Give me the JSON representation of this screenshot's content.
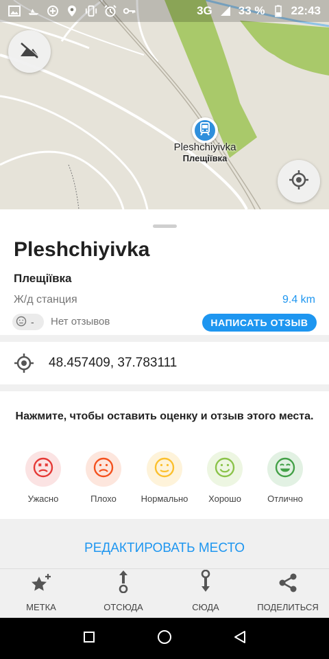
{
  "status_bar": {
    "network": "3G",
    "battery": "33 %",
    "time": "22:43",
    "icons": [
      "image-icon",
      "speedboat-icon",
      "data-saver-icon",
      "location-icon",
      "vibrate-icon",
      "alarm-icon",
      "key-icon",
      "signal-icon",
      "battery-icon"
    ]
  },
  "map": {
    "station_name": "Pleshchiyivka",
    "station_name_local": "Плещіївка",
    "icons": [
      "terrain-off-icon",
      "my-location-icon",
      "train-station-icon"
    ]
  },
  "place": {
    "title": "Pleshchiyivka",
    "subtitle": "Плещіївка",
    "category": "Ж/д станция",
    "distance": "9.4 km",
    "rating_value": "-",
    "reviews_text": "Нет отзывов",
    "write_review_label": "НАПИСАТЬ ОТЗЫВ"
  },
  "coordinates": {
    "value": "48.457409, 37.783111"
  },
  "rate": {
    "prompt": "Нажмите, чтобы оставить оценку и отзыв этого места.",
    "options": [
      {
        "label": "Ужасно",
        "color": "#e53935",
        "bg": "#fbe3e3"
      },
      {
        "label": "Плохо",
        "color": "#f4511e",
        "bg": "#fde6dd"
      },
      {
        "label": "Нормально",
        "color": "#fbc02d",
        "bg": "#fef3da"
      },
      {
        "label": "Хорошо",
        "color": "#8bc34a",
        "bg": "#edf6e2"
      },
      {
        "label": "Отлично",
        "color": "#43a047",
        "bg": "#e2f1e3"
      }
    ]
  },
  "edit_place_label": "РЕДАКТИРОВАТЬ МЕСТО",
  "actions": [
    {
      "label": "МЕТКА",
      "icon": "bookmark-star-icon"
    },
    {
      "label": "ОТСЮДА",
      "icon": "route-from-icon"
    },
    {
      "label": "СЮДА",
      "icon": "route-to-icon"
    },
    {
      "label": "ПОДЕЛИТЬСЯ",
      "icon": "share-icon"
    }
  ],
  "colors": {
    "accent": "#1e96f0",
    "map_water": "#8fc3e6",
    "map_park": "#a9c96a"
  }
}
